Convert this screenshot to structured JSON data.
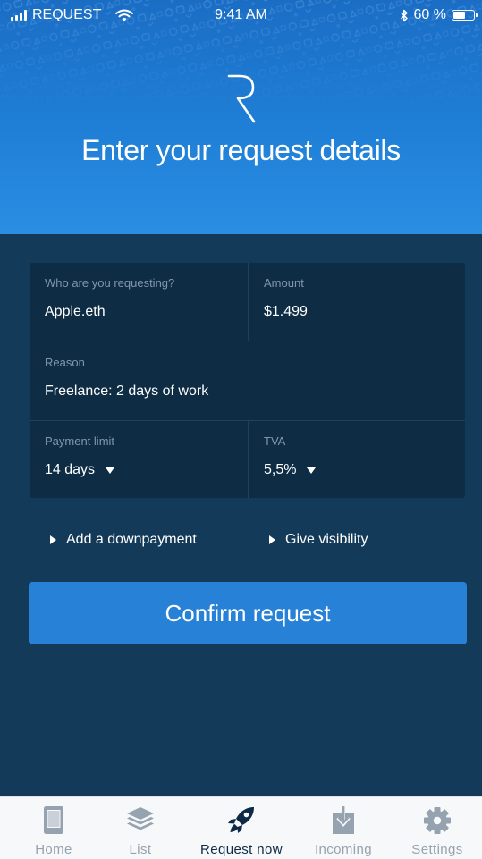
{
  "status_bar": {
    "carrier": "REQUEST",
    "time": "9:41 AM",
    "battery": "60 %",
    "battery_level": 0.6,
    "icons": [
      "signal-icon",
      "wifi-icon",
      "bluetooth-icon",
      "battery-icon"
    ]
  },
  "header": {
    "logo_icon": "request-logo-icon",
    "title": "Enter your request details"
  },
  "form": {
    "requestee": {
      "label": "Who are you requesting?",
      "value": "Apple.eth"
    },
    "amount": {
      "label": "Amount",
      "value": "$1.499"
    },
    "reason": {
      "label": "Reason",
      "value": "Freelance: 2 days of work"
    },
    "payment_limit": {
      "label": "Payment limit",
      "value": "14 days"
    },
    "tva": {
      "label": "TVA",
      "value": "5,5%"
    }
  },
  "options": {
    "downpayment": "Add a downpayment",
    "visibility": "Give visibility"
  },
  "confirm_label": "Confirm request",
  "tabbar": {
    "active": "request_now",
    "tabs": [
      {
        "id": "home",
        "label": "Home",
        "icon": "tablet-icon"
      },
      {
        "id": "list",
        "label": "List",
        "icon": "layers-icon"
      },
      {
        "id": "request_now",
        "label": "Request now",
        "icon": "rocket-icon"
      },
      {
        "id": "incoming",
        "label": "Incoming",
        "icon": "download-icon"
      },
      {
        "id": "settings",
        "label": "Settings",
        "icon": "gear-icon"
      }
    ]
  },
  "colors": {
    "header_gradient_top": "#1b6dc4",
    "header_gradient_bottom": "#2a8ee3",
    "background": "#133a59",
    "card": "#0e2d45",
    "accent": "#2781d6",
    "tab_active": "#0c2a45",
    "tab_inactive": "#95a2af"
  }
}
